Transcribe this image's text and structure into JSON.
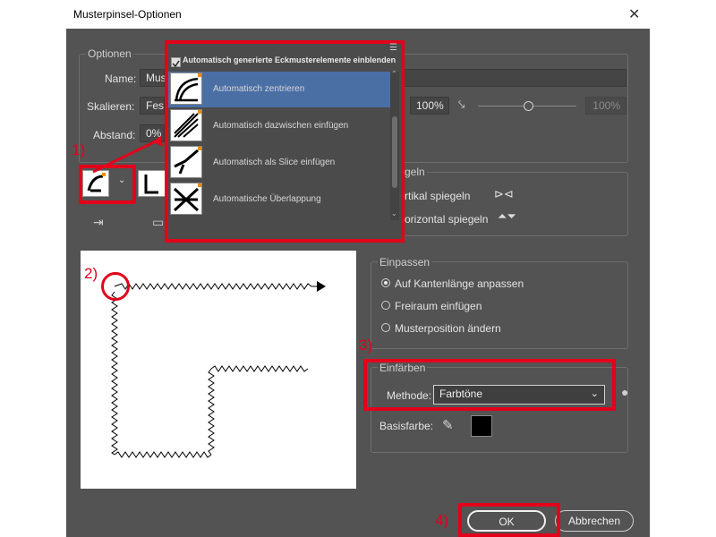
{
  "dialog": {
    "title": "Musterpinsel-Optionen",
    "close_symbol": "✕"
  },
  "optionen": {
    "group_label": "Optionen",
    "name_label": "Name:",
    "name_value": "Mus",
    "skalieren_label": "Skalieren:",
    "skalieren_value": "Fes",
    "abstand_label": "Abstand:",
    "abstand_value": "0%",
    "scale_percent": "100%",
    "scale_percent_max": "100%"
  },
  "dropdown": {
    "checkbox_label": "Automatisch generierte Eckmusterelemente einblenden",
    "items": [
      {
        "label": "Automatisch zentrieren",
        "selected": true
      },
      {
        "label": "Automatisch dazwischen einfügen",
        "selected": false
      },
      {
        "label": "Automatisch als Slice einfügen",
        "selected": false
      },
      {
        "label": "Automatische Überlappung",
        "selected": false
      }
    ]
  },
  "spiegeln": {
    "group_label": "geln",
    "vertikal_label": "rtikal spiegeln",
    "horizontal_label": "orizontal spiegeln"
  },
  "einpassen": {
    "group_label": "Einpassen",
    "options": [
      {
        "label": "Auf Kantenlänge anpassen",
        "selected": true
      },
      {
        "label": "Freiraum einfügen",
        "selected": false
      },
      {
        "label": "Musterposition ändern",
        "selected": false
      }
    ]
  },
  "einfaerben": {
    "group_label": "Einfärben",
    "methode_label": "Methode:",
    "methode_value": "Farbtöne",
    "basisfarbe_label": "Basisfarbe:",
    "basisfarbe_color": "#000000"
  },
  "buttons": {
    "ok": "OK",
    "cancel": "Abbrechen"
  },
  "markers": {
    "m1": "1)",
    "m2": "2)",
    "m3": "3)",
    "m4": "4)"
  },
  "colors": {
    "annotation_red": "#e3001b",
    "dialog_bg": "#535353",
    "selected_item": "#4a6fa5"
  }
}
